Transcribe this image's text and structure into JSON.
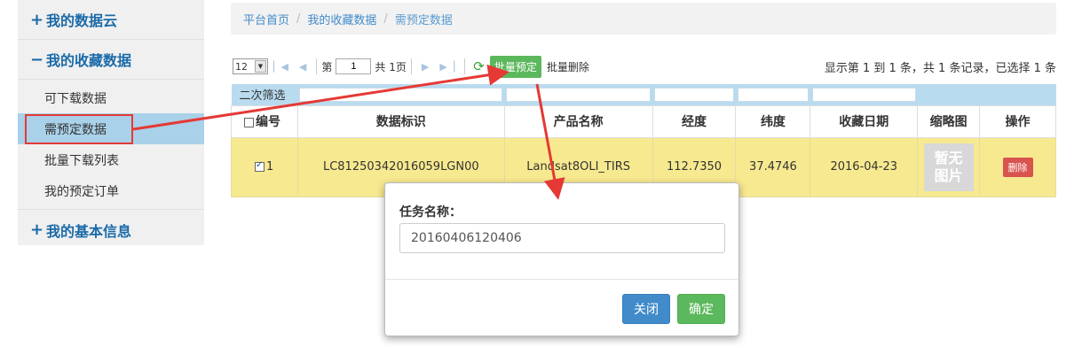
{
  "sidebar": {
    "groups": [
      {
        "sign": "+",
        "label": "我的数据云"
      },
      {
        "sign": "−",
        "label": "我的收藏数据"
      },
      {
        "sign": "+",
        "label": "我的基本信息"
      }
    ],
    "items": [
      {
        "label": "可下载数据"
      },
      {
        "label": "需预定数据"
      },
      {
        "label": "批量下载列表"
      },
      {
        "label": "我的预定订单"
      }
    ]
  },
  "breadcrumb": [
    "平台首页",
    "我的收藏数据",
    "需预定数据"
  ],
  "toolbar": {
    "page_size": "12",
    "page_prefix": "第",
    "page_value": "1",
    "page_total": "共 1页",
    "batch_reserve": "批量预定",
    "batch_delete": "批量删除",
    "info": "显示第 1 到 1 条，共 1 条记录，已选择 1 条"
  },
  "table": {
    "filter_label": "二次筛选",
    "headers": [
      "编号",
      "数据标识",
      "产品名称",
      "经度",
      "纬度",
      "收藏日期",
      "缩略图",
      "操作"
    ],
    "rows": [
      {
        "id": "1",
        "data_id": "LC81250342016059LGN00",
        "product": "Landsat8OLI_TIRS",
        "lon": "112.7350",
        "lat": "37.4746",
        "date": "2016-04-23",
        "thumb_line1": "暂无",
        "thumb_line2": "图片",
        "action": "删除"
      }
    ]
  },
  "modal": {
    "label": "任务名称：",
    "value": "20160406120406",
    "close": "关闭",
    "ok": "确定"
  },
  "colors": {
    "arrow": "#e53935",
    "accent": "#1a6aa8",
    "row_highlight": "#f7e98f"
  }
}
